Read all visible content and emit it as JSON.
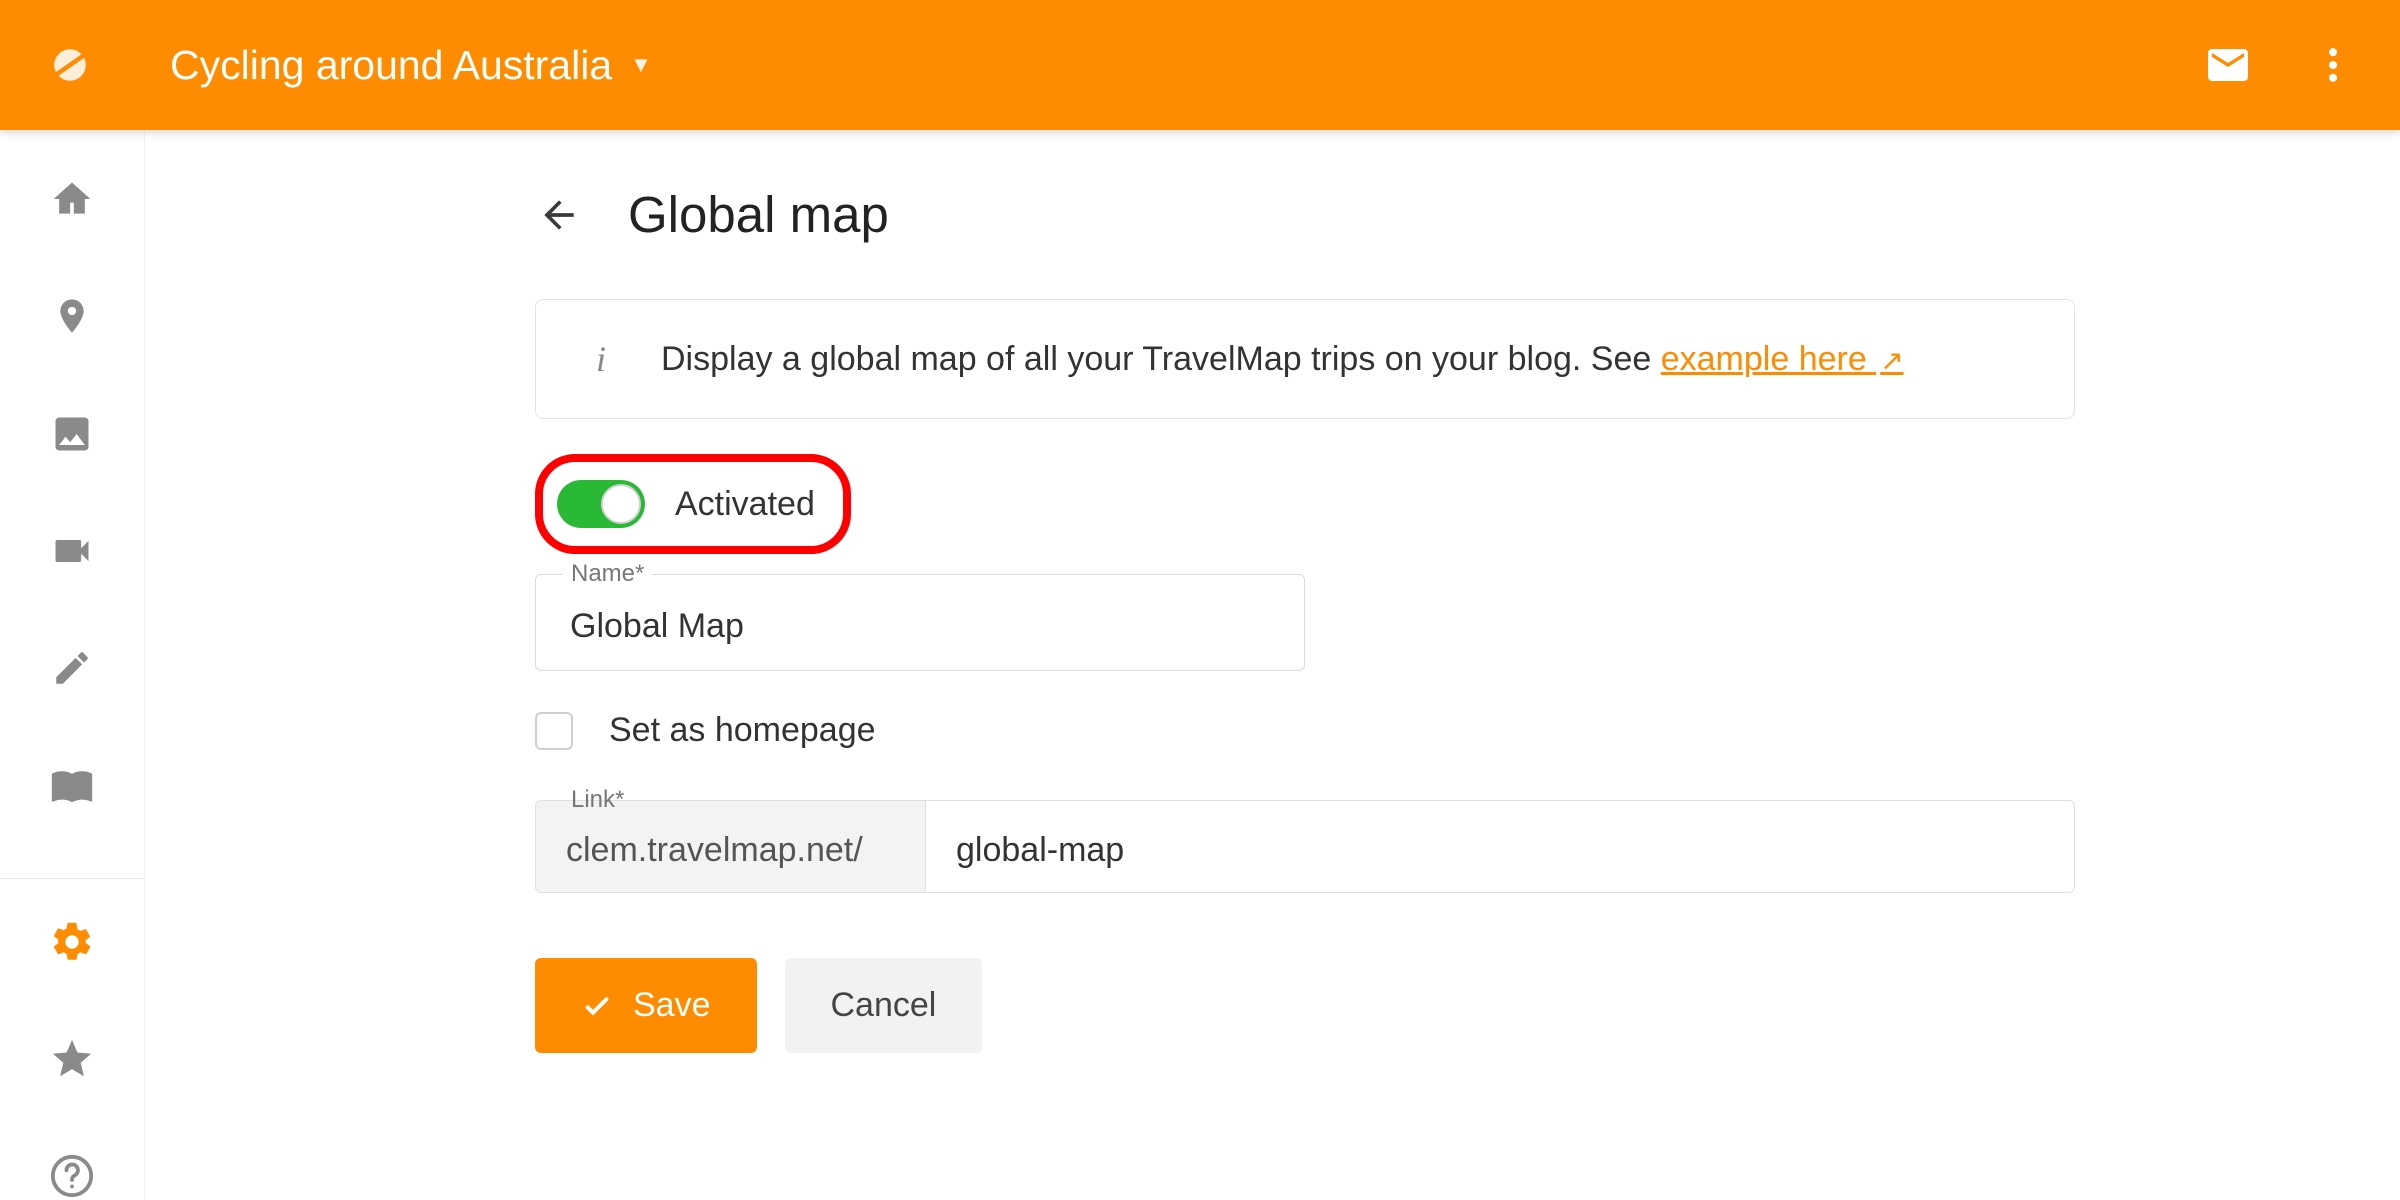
{
  "topbar": {
    "project_name": "Cycling around Australia"
  },
  "page": {
    "title": "Global map"
  },
  "info": {
    "text_before": "Display a global map of all your TravelMap trips on your blog. See ",
    "link_text": "example here ",
    "text_after": ""
  },
  "toggle": {
    "label": "Activated",
    "on": true
  },
  "name_field": {
    "label": "Name*",
    "value": "Global Map"
  },
  "homepage_checkbox": {
    "label": "Set as homepage",
    "checked": false
  },
  "link_field": {
    "label": "Link*",
    "prefix": "clem.travelmap.net/",
    "value": "global-map"
  },
  "actions": {
    "save": "Save",
    "cancel": "Cancel"
  }
}
